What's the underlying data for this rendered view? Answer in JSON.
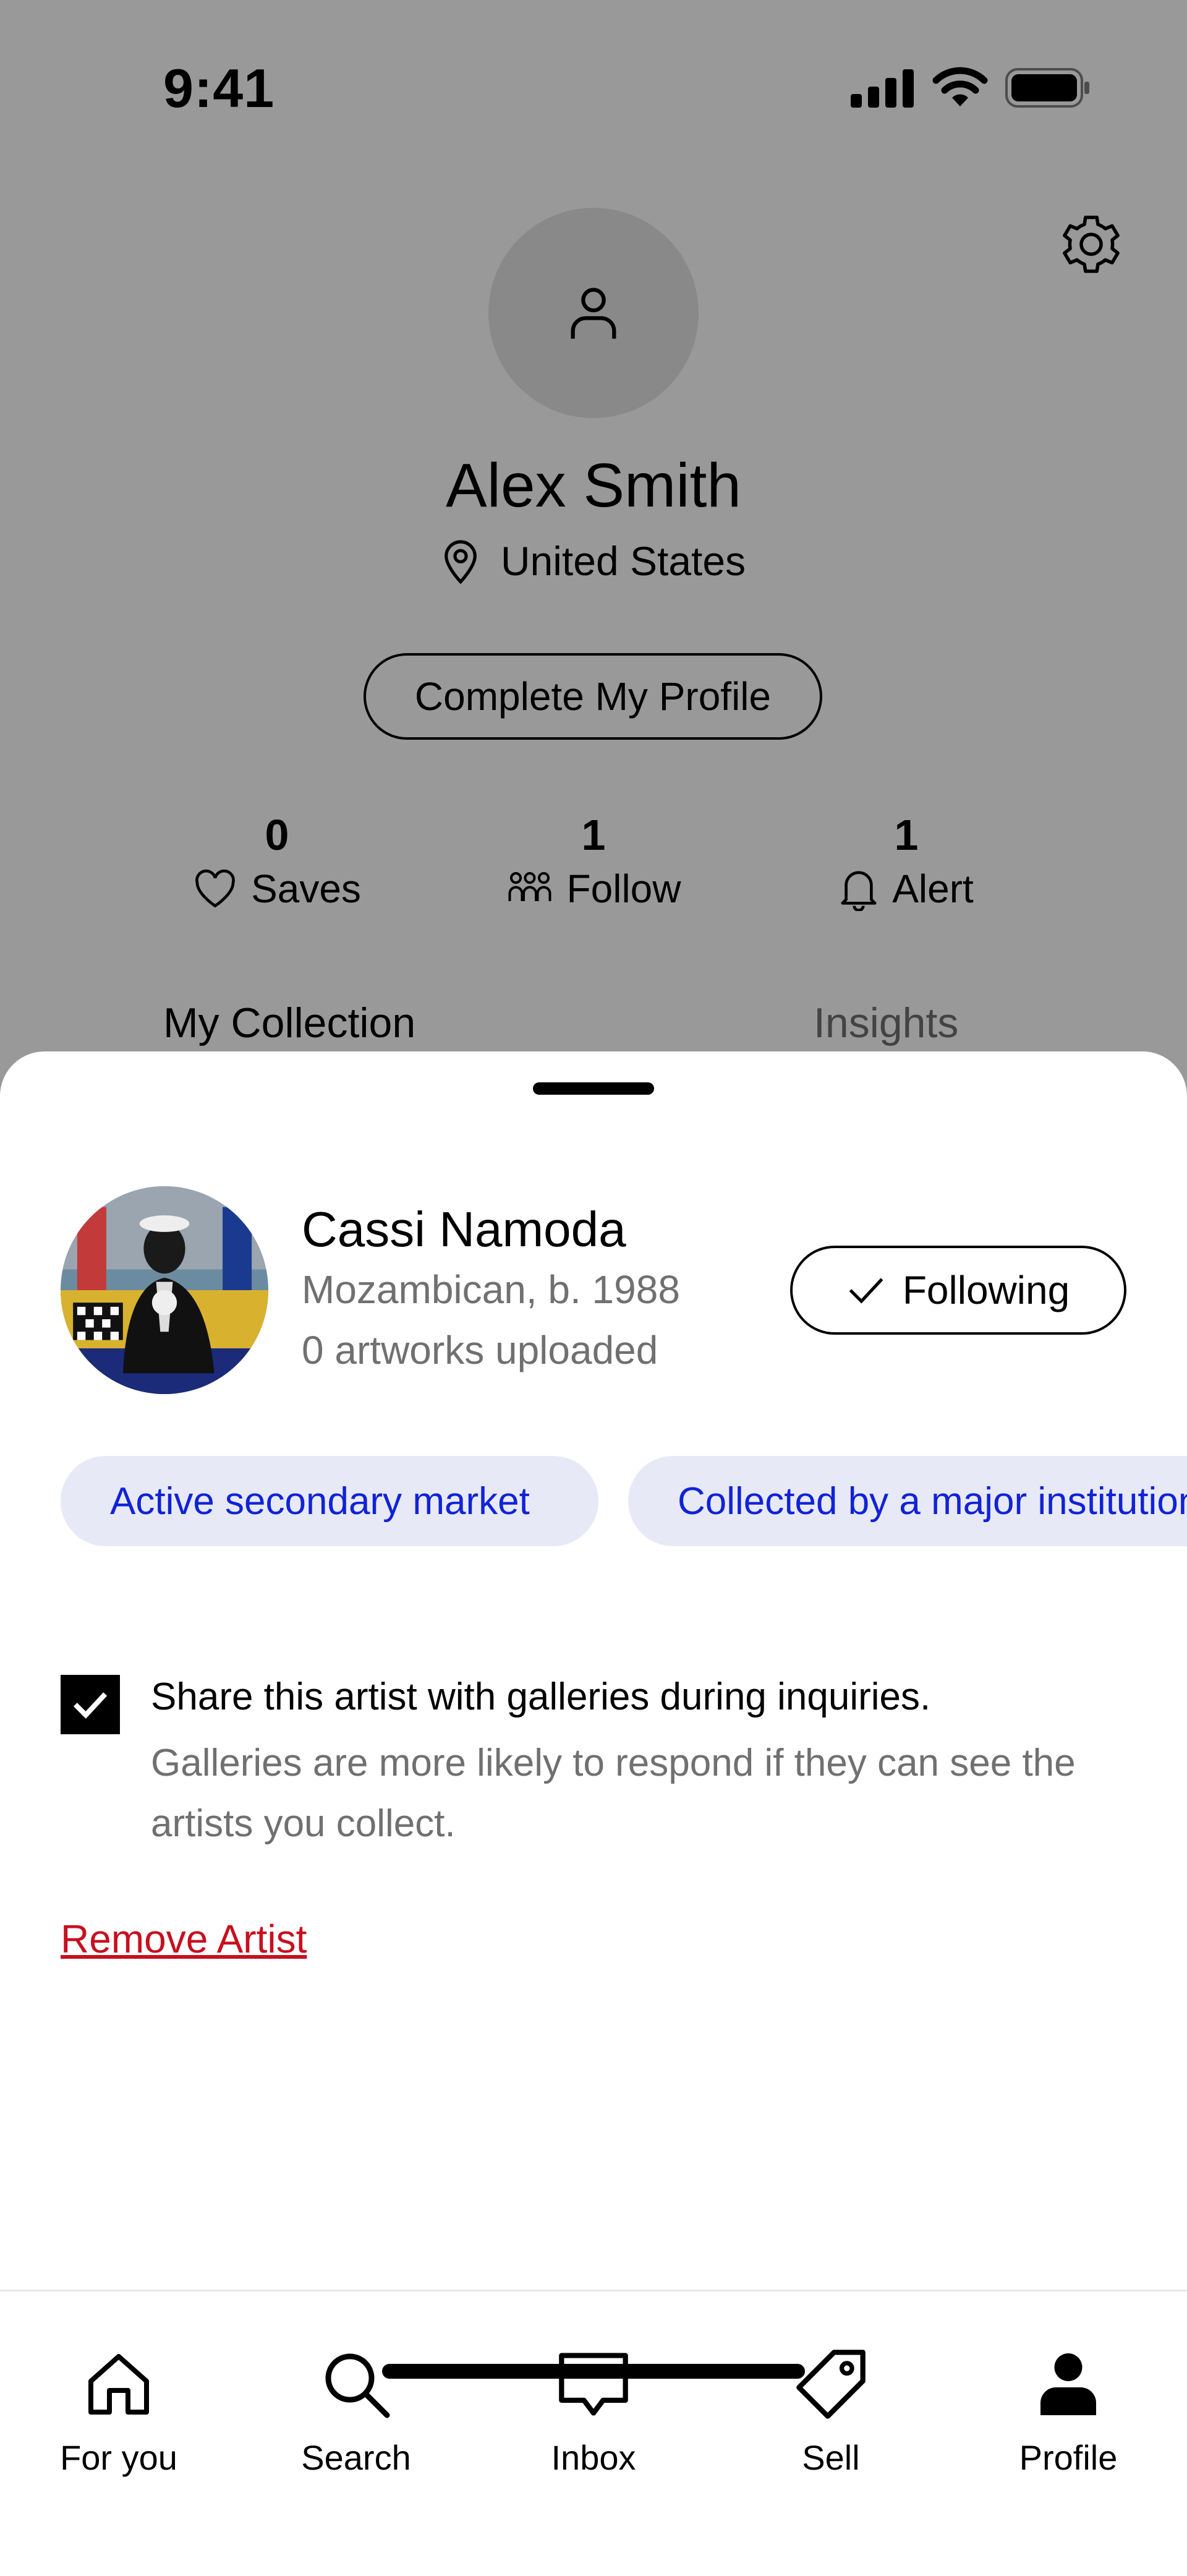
{
  "status_bar": {
    "time": "9:41"
  },
  "profile": {
    "name": "Alex Smith",
    "location": "United States",
    "complete_profile_label": "Complete My Profile",
    "stats": [
      {
        "count": "0",
        "label": "Saves",
        "icon": "heart-icon"
      },
      {
        "count": "1",
        "label": "Follow",
        "icon": "people-icon"
      },
      {
        "count": "1",
        "label": "Alert",
        "icon": "bell-icon"
      }
    ],
    "tabs": [
      "My Collection",
      "Insights"
    ]
  },
  "sheet": {
    "artist": {
      "name": "Cassi Namoda",
      "meta": "Mozambican, b. 1988",
      "artworks": "0 artworks uploaded"
    },
    "follow_button": "Following",
    "chips": [
      "Active secondary market",
      "Collected by a major institution"
    ],
    "share": {
      "checked": true,
      "title": "Share this artist with galleries during inquiries.",
      "description": "Galleries are more likely to respond if they can see the artists you collect."
    },
    "remove_label": "Remove Artist"
  },
  "tab_bar": {
    "items": [
      {
        "label": "For you",
        "icon": "home-icon"
      },
      {
        "label": "Search",
        "icon": "search-icon"
      },
      {
        "label": "Inbox",
        "icon": "chat-icon"
      },
      {
        "label": "Sell",
        "icon": "tag-icon"
      },
      {
        "label": "Profile",
        "icon": "person-icon",
        "active": true
      }
    ]
  },
  "colors": {
    "chip_bg": "#e8e9f7",
    "chip_text": "#1023d7",
    "remove": "#c80f1e",
    "muted": "#707070"
  }
}
